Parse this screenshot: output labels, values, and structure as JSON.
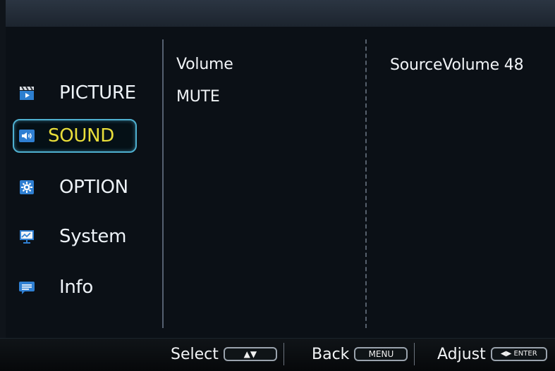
{
  "sidebar": {
    "items": [
      {
        "label": "PICTURE",
        "icon": "clapperboard-icon"
      },
      {
        "label": "SOUND",
        "icon": "speaker-icon",
        "selected": true
      },
      {
        "label": "OPTION",
        "icon": "gear-icon"
      },
      {
        "label": "System",
        "icon": "monitor-chart-icon"
      },
      {
        "label": "Info",
        "icon": "chat-bubble-icon"
      }
    ]
  },
  "content": {
    "options": [
      "Volume",
      "MUTE"
    ],
    "detail": "SourceVolume 48"
  },
  "footer": {
    "select_label": "Select",
    "select_key": "▲▼",
    "back_label": "Back",
    "back_key": "MENU",
    "adjust_label": "Adjust",
    "adjust_key": "◀▶ ENTER"
  },
  "colors": {
    "selected_text": "#e9de3a",
    "selected_border": "#4fb0d0",
    "text": "#eef3f8",
    "background": "#0b1016"
  }
}
